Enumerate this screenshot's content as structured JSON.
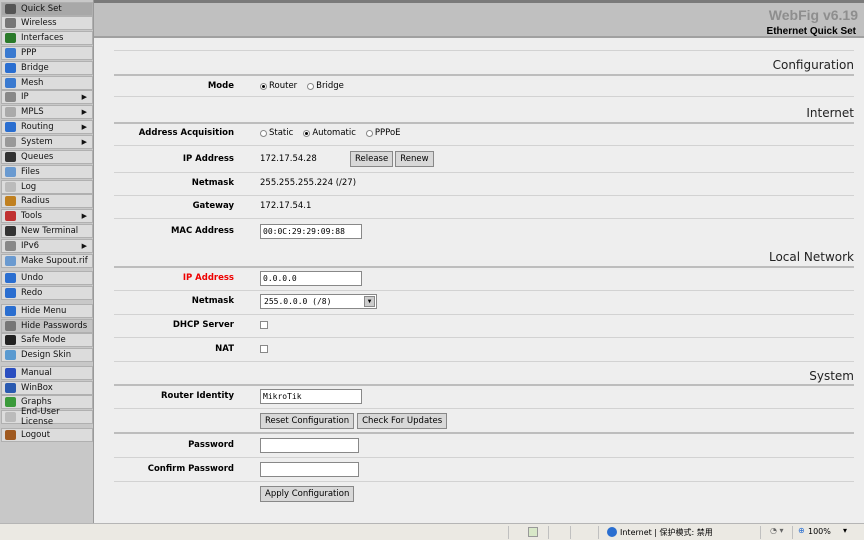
{
  "sidebar": {
    "items": [
      {
        "label": "Quick Set",
        "icon": "quick-set-icon",
        "color": "#555"
      },
      {
        "label": "Wireless",
        "icon": "wireless-icon",
        "color": "#777"
      },
      {
        "label": "Interfaces",
        "icon": "interfaces-icon",
        "color": "#2a7a2a"
      },
      {
        "label": "PPP",
        "icon": "ppp-icon",
        "color": "#3a7ad0"
      },
      {
        "label": "Bridge",
        "icon": "bridge-icon",
        "color": "#2a6ed0"
      },
      {
        "label": "Mesh",
        "icon": "mesh-icon",
        "color": "#3a7ad0"
      },
      {
        "label": "IP",
        "icon": "ip-icon",
        "color": "#888",
        "submenu": true
      },
      {
        "label": "MPLS",
        "icon": "mpls-icon",
        "color": "#aaa",
        "submenu": true
      },
      {
        "label": "Routing",
        "icon": "routing-icon",
        "color": "#2a6ed0",
        "submenu": true
      },
      {
        "label": "System",
        "icon": "system-gear-icon",
        "color": "#999",
        "submenu": true
      },
      {
        "label": "Queues",
        "icon": "queues-icon",
        "color": "#333"
      },
      {
        "label": "Files",
        "icon": "files-folder-icon",
        "color": "#6a9ad0"
      },
      {
        "label": "Log",
        "icon": "log-icon",
        "color": "#bbb"
      },
      {
        "label": "Radius",
        "icon": "radius-users-icon",
        "color": "#c08020"
      },
      {
        "label": "Tools",
        "icon": "tools-icon",
        "color": "#c03030",
        "submenu": true
      },
      {
        "label": "New Terminal",
        "icon": "terminal-icon",
        "color": "#333"
      },
      {
        "label": "IPv6",
        "icon": "ipv6-icon",
        "color": "#888",
        "submenu": true
      },
      {
        "label": "Make Supout.rif",
        "icon": "supout-file-icon",
        "color": "#6a9ad0"
      },
      {
        "label": "Undo",
        "icon": "undo-icon",
        "color": "#2a6ed0"
      },
      {
        "label": "Redo",
        "icon": "redo-icon",
        "color": "#2a6ed0"
      },
      {
        "label": "Hide Menu",
        "icon": "hide-menu-icon",
        "color": "#2a6ed0"
      },
      {
        "label": "Hide Passwords",
        "icon": "hide-passwords-icon",
        "color": "#777"
      },
      {
        "label": "Safe Mode",
        "icon": "umbrella-icon",
        "color": "#222"
      },
      {
        "label": "Design Skin",
        "icon": "design-skin-icon",
        "color": "#5a9ad0"
      },
      {
        "label": "Manual",
        "icon": "manual-help-icon",
        "color": "#2a4ec0"
      },
      {
        "label": "WinBox",
        "icon": "winbox-icon",
        "color": "#2a5ab0"
      },
      {
        "label": "Graphs",
        "icon": "graphs-icon",
        "color": "#3a9a3a"
      },
      {
        "label": "End-User License",
        "icon": "license-icon",
        "color": "#bbb"
      },
      {
        "label": "Logout",
        "icon": "logout-door-icon",
        "color": "#a05a20"
      }
    ]
  },
  "header": {
    "brand": "WebFig v6.19",
    "title": "Ethernet Quick Set"
  },
  "sections": {
    "configuration": "Configuration",
    "internet": "Internet",
    "local": "Local Network",
    "system": "System"
  },
  "form": {
    "mode": {
      "label": "Mode",
      "options": [
        "Router",
        "Bridge"
      ],
      "selected": "Router"
    },
    "acq": {
      "label": "Address Acquisition",
      "options": [
        "Static",
        "Automatic",
        "PPPoE"
      ],
      "selected": "Automatic"
    },
    "ip": {
      "label": "IP Address",
      "value": "172.17.54.28",
      "release": "Release",
      "renew": "Renew"
    },
    "netmask": {
      "label": "Netmask",
      "value": "255.255.255.224 (/27)"
    },
    "gateway": {
      "label": "Gateway",
      "value": "172.17.54.1"
    },
    "mac": {
      "label": "MAC Address",
      "value": "00:0C:29:29:09:88"
    },
    "lan_ip": {
      "label": "IP Address",
      "value": "0.0.0.0",
      "color": "#e00000"
    },
    "lan_mask": {
      "label": "Netmask",
      "value": "255.0.0.0 (/8)"
    },
    "dhcp": {
      "label": "DHCP Server",
      "checked": false
    },
    "nat": {
      "label": "NAT",
      "checked": false
    },
    "identity": {
      "label": "Router Identity",
      "value": "MikroTik"
    },
    "reset": "Reset Configuration",
    "updates": "Check For Updates",
    "password": {
      "label": "Password",
      "value": ""
    },
    "confirm": {
      "label": "Confirm Password",
      "value": ""
    },
    "apply": "Apply Configuration"
  },
  "statusbar": {
    "zone": "Internet | 保护模式: 禁用",
    "zoom": "100%"
  }
}
